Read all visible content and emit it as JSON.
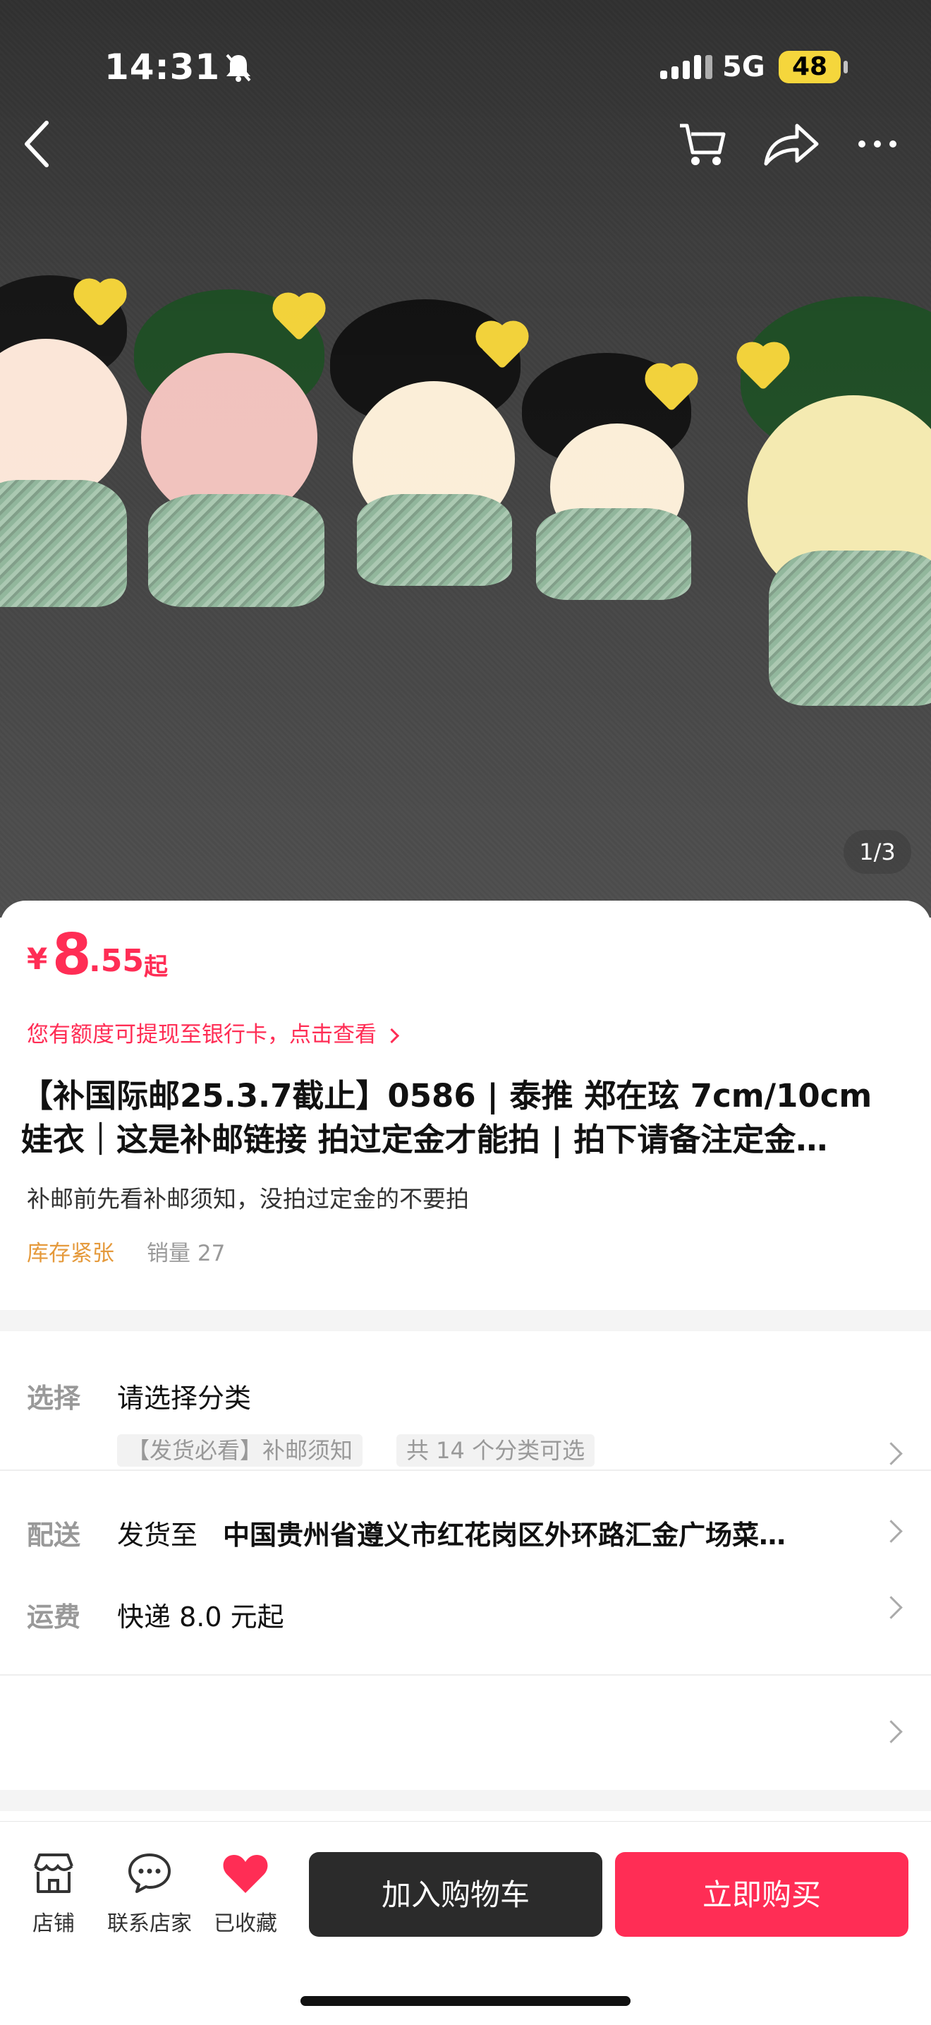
{
  "status_bar": {
    "time": "14:31",
    "network": "5G",
    "battery": "48"
  },
  "gallery": {
    "indicator": "1/3"
  },
  "price": {
    "currency": "¥",
    "integer": "8",
    "decimal": ".55",
    "suffix": "起"
  },
  "credit_notice": "您有额度可提现至银行卡，点击查看",
  "product": {
    "title_line1": "【补国际邮25.3.7截止】0586 | 泰推 郑在玹 7cm/10cm",
    "title_line2": "娃衣｜这是补邮链接 拍过定金才能拍 | 拍下请备注定金…",
    "subtitle": "补邮前先看补邮须知，没拍过定金的不要拍",
    "stock_tag": "库存紧张",
    "sales": "销量 27"
  },
  "options": {
    "select_label": "选择",
    "select_value": "请选择分类",
    "chip_1": "【发货必看】补邮须知",
    "chip_2": "共 14 个分类可选",
    "delivery_label": "配送",
    "delivery_prefix": "发货至",
    "delivery_address": "中国贵州省遵义市红花岗区外环路汇金广场菜…",
    "shipping_label": "运费",
    "shipping_value": "快递 8.0 元起"
  },
  "bottom_bar": {
    "store_label": "店铺",
    "contact_label": "联系店家",
    "favorite_label": "已收藏",
    "cart_button": "加入购物车",
    "buy_button": "立即购买"
  },
  "colors": {
    "accent": "#ff2d55",
    "stock": "#e59a3c",
    "cart_button": "#2b2b2b"
  }
}
